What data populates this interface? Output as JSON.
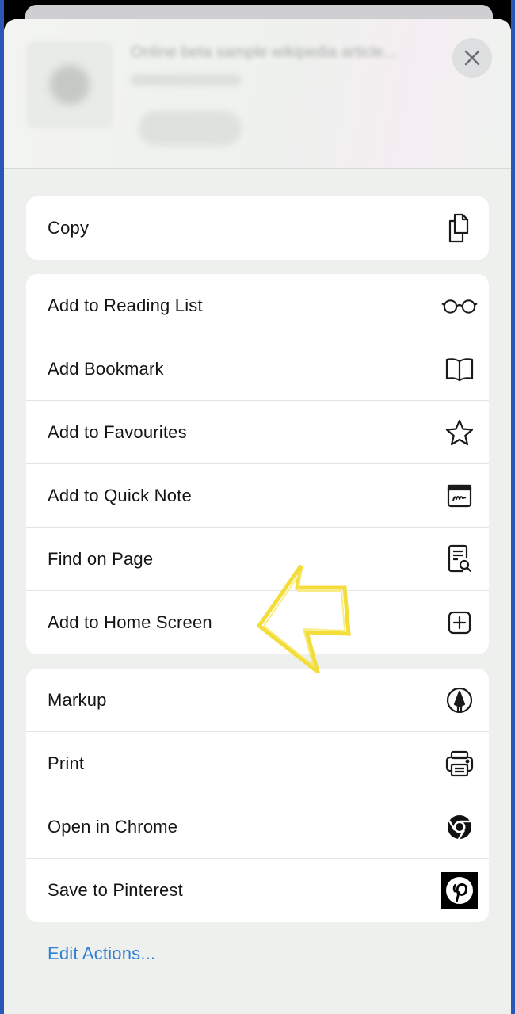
{
  "header": {
    "preview_title": "Online beta sample wikipedia article...",
    "close_icon": "close-icon"
  },
  "groups": [
    {
      "rows": [
        {
          "label": "Copy",
          "icon": "copy-icon"
        }
      ]
    },
    {
      "rows": [
        {
          "label": "Add to Reading List",
          "icon": "glasses-icon"
        },
        {
          "label": "Add Bookmark",
          "icon": "book-icon"
        },
        {
          "label": "Add to Favourites",
          "icon": "star-icon"
        },
        {
          "label": "Add to Quick Note",
          "icon": "quick-note-icon"
        },
        {
          "label": "Find on Page",
          "icon": "find-on-page-icon"
        },
        {
          "label": "Add to Home Screen",
          "icon": "add-square-icon"
        }
      ]
    },
    {
      "rows": [
        {
          "label": "Markup",
          "icon": "markup-icon"
        },
        {
          "label": "Print",
          "icon": "printer-icon"
        },
        {
          "label": "Open in Chrome",
          "icon": "chrome-icon"
        },
        {
          "label": "Save to Pinterest",
          "icon": "pinterest-icon"
        }
      ]
    }
  ],
  "edit_actions": "Edit Actions...",
  "colors": {
    "accent": "#2f7fd6",
    "highlight_arrow": "#f4dc3a",
    "frame_border": "#2a56b8"
  }
}
